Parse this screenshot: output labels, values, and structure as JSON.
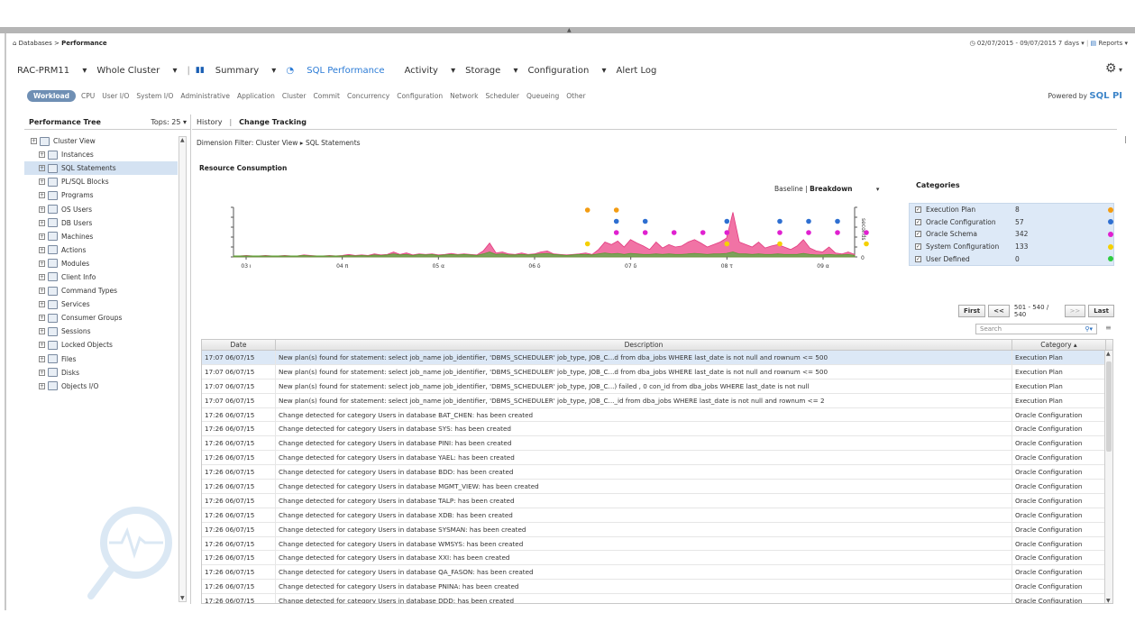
{
  "breadcrumb": {
    "root": "Databases",
    "separator": ">",
    "current": "Performance"
  },
  "date_range": {
    "text": "02/07/2015 - 09/07/2015 7 days",
    "reports": "Reports"
  },
  "nav": {
    "db": "RAC-PRM11",
    "scope": "Whole Cluster",
    "items": [
      "Summary",
      "SQL Performance",
      "Activity",
      "Storage",
      "Configuration",
      "Alert Log"
    ]
  },
  "workload_tabs": [
    "Workload",
    "CPU",
    "User I/O",
    "System I/O",
    "Administrative",
    "Application",
    "Cluster",
    "Commit",
    "Concurrency",
    "Configuration",
    "Network",
    "Scheduler",
    "Queueing",
    "Other"
  ],
  "powered_by": {
    "prefix": "Powered by",
    "brand": "SQL PI"
  },
  "perf_tree": {
    "title": "Performance Tree",
    "tops": "Tops: 25",
    "items": [
      "Cluster View",
      "Instances",
      "SQL Statements",
      "PL/SQL Blocks",
      "Programs",
      "OS Users",
      "DB Users",
      "Machines",
      "Actions",
      "Modules",
      "Client Info",
      "Command Types",
      "Services",
      "Consumer Groups",
      "Sessions",
      "Locked Objects",
      "Files",
      "Disks",
      "Objects I/O"
    ],
    "selected_index": 2
  },
  "content_tabs": {
    "history": "History",
    "separator": "|",
    "change_tracking": "Change Tracking"
  },
  "dimension_filter": "Dimension Filter: Cluster View ▸ SQL Statements",
  "resource_title": "Resource Consumption",
  "baseline": {
    "baseline": "Baseline",
    "separator": "|",
    "breakdown": "Breakdown"
  },
  "categories": {
    "title": "Categories",
    "items": [
      {
        "name": "Execution Plan",
        "count": "8",
        "color": "#f39c12"
      },
      {
        "name": "Oracle Configuration",
        "count": "57",
        "color": "#2e6fd1"
      },
      {
        "name": "Oracle Schema",
        "count": "342",
        "color": "#e020d0"
      },
      {
        "name": "System Configuration",
        "count": "133",
        "color": "#f5d000"
      },
      {
        "name": "User Defined",
        "count": "0",
        "color": "#2ecc40"
      }
    ]
  },
  "chart_data": {
    "type": "area",
    "x_ticks": [
      "03 ı",
      "04 π",
      "05 α",
      "06 δ",
      "07 δ",
      "08 τ",
      "09 α"
    ],
    "ylabel": "seconds",
    "y_ticks": [
      "0"
    ],
    "series": [
      {
        "values": [
          0.02,
          0.02,
          0.03,
          0.02,
          0.02,
          0.03,
          0.02,
          0.02,
          0.03,
          0.02,
          0.02,
          0.04,
          0.03,
          0.02,
          0.02,
          0.03,
          0.02,
          0.03,
          0.05,
          0.03,
          0.04,
          0.03,
          0.06,
          0.04,
          0.05,
          0.1,
          0.05,
          0.08,
          0.04,
          0.06,
          0.05,
          0.06,
          0.04,
          0.05,
          0.07,
          0.05,
          0.06,
          0.05,
          0.04,
          0.12,
          0.28,
          0.08,
          0.1,
          0.06,
          0.05,
          0.08,
          0.05,
          0.06,
          0.1,
          0.12,
          0.06,
          0.05,
          0.04,
          0.05,
          0.06,
          0.08,
          0.05,
          0.15,
          0.3,
          0.25,
          0.32,
          0.2,
          0.35,
          0.28,
          0.22,
          0.15,
          0.3,
          0.18,
          0.25,
          0.2,
          0.22,
          0.3,
          0.35,
          0.28,
          0.2,
          0.25,
          0.3,
          0.38,
          0.9,
          0.3,
          0.25,
          0.2,
          0.3,
          0.18,
          0.22,
          0.25,
          0.2,
          0.15,
          0.22,
          0.35,
          0.18,
          0.12,
          0.1,
          0.2,
          0.08,
          0.06,
          0.1,
          0.05
        ]
      },
      {
        "values": [
          0.02,
          0.02,
          0.02,
          0.02,
          0.02,
          0.02,
          0.02,
          0.02,
          0.02,
          0.02,
          0.02,
          0.03,
          0.02,
          0.02,
          0.02,
          0.02,
          0.02,
          0.02,
          0.03,
          0.02,
          0.03,
          0.02,
          0.04,
          0.03,
          0.04,
          0.06,
          0.04,
          0.05,
          0.03,
          0.05,
          0.04,
          0.05,
          0.03,
          0.04,
          0.05,
          0.04,
          0.05,
          0.04,
          0.03,
          0.06,
          0.1,
          0.05,
          0.06,
          0.04,
          0.04,
          0.05,
          0.04,
          0.05,
          0.06,
          0.07,
          0.05,
          0.04,
          0.03,
          0.04,
          0.05,
          0.05,
          0.04,
          0.06,
          0.08,
          0.06,
          0.07,
          0.05,
          0.07,
          0.06,
          0.05,
          0.05,
          0.06,
          0.05,
          0.06,
          0.05,
          0.05,
          0.06,
          0.07,
          0.06,
          0.05,
          0.06,
          0.06,
          0.07,
          0.1,
          0.06,
          0.06,
          0.05,
          0.06,
          0.05,
          0.05,
          0.06,
          0.05,
          0.05,
          0.05,
          0.07,
          0.05,
          0.04,
          0.04,
          0.05,
          0.04,
          0.04,
          0.05,
          0.03
        ]
      }
    ],
    "markers": [
      {
        "x_tick": 4,
        "offset": -0.45,
        "rows": [
          "Execution Plan",
          "System Configuration"
        ]
      },
      {
        "x_tick": 4,
        "offset": -0.15,
        "rows": [
          "Execution Plan",
          "Oracle Configuration",
          "Oracle Schema"
        ]
      },
      {
        "x_tick": 4,
        "offset": 0.15,
        "rows": [
          "Oracle Configuration",
          "Oracle Schema"
        ]
      },
      {
        "x_tick": 4,
        "offset": 0.45,
        "rows": [
          "Oracle Schema"
        ]
      },
      {
        "x_tick": 5,
        "offset": -0.25,
        "rows": [
          "Oracle Schema"
        ]
      },
      {
        "x_tick": 5,
        "offset": 0.0,
        "rows": [
          "Oracle Configuration",
          "Oracle Schema",
          "System Configuration"
        ]
      },
      {
        "x_tick": 5,
        "offset": 0.55,
        "rows": [
          "Oracle Configuration",
          "Oracle Schema",
          "System Configuration"
        ]
      },
      {
        "x_tick": 6,
        "offset": -0.15,
        "rows": [
          "Oracle Configuration",
          "Oracle Schema"
        ]
      },
      {
        "x_tick": 6,
        "offset": 0.15,
        "rows": [
          "Oracle Configuration",
          "Oracle Schema"
        ]
      },
      {
        "x_tick": 6,
        "offset": 0.45,
        "rows": [
          "Oracle Schema",
          "System Configuration"
        ]
      },
      {
        "x_tick": 6,
        "offset": 0.75,
        "rows": [
          "Oracle Schema",
          "System Configuration"
        ]
      }
    ]
  },
  "pager": {
    "first": "First",
    "prev": "<<",
    "info": "501 - 540 / 540",
    "next": ">>",
    "last": "Last"
  },
  "search": {
    "placeholder": "Search"
  },
  "grid": {
    "columns": [
      "Date",
      "Description",
      "Category ▴"
    ],
    "selected_index": 0,
    "rows": [
      {
        "date": "17:07 06/07/15",
        "desc": "New plan(s) found for statement: select job_name job_identifier, 'DBMS_SCHEDULER' job_type, JOB_C...d from dba_jobs WHERE last_date is not null and rownum <= 500",
        "cat": "Execution Plan"
      },
      {
        "date": "17:07 06/07/15",
        "desc": "New plan(s) found for statement: select job_name job_identifier, 'DBMS_SCHEDULER' job_type, JOB_C...d from dba_jobs WHERE last_date is not null and rownum <= 500",
        "cat": "Execution Plan"
      },
      {
        "date": "17:07 06/07/15",
        "desc": "New plan(s) found for statement: select job_name job_identifier, 'DBMS_SCHEDULER' job_type, JOB_C...) failed , 0 con_id from dba_jobs WHERE last_date is not null",
        "cat": "Execution Plan"
      },
      {
        "date": "17:07 06/07/15",
        "desc": "New plan(s) found for statement: select job_name job_identifier, 'DBMS_SCHEDULER' job_type, JOB_C..._id from dba_jobs WHERE last_date is not null and rownum <= 2",
        "cat": "Execution Plan"
      },
      {
        "date": "17:26 06/07/15",
        "desc": "Change detected for category Users in database BAT_CHEN: has been created",
        "cat": "Oracle Configuration"
      },
      {
        "date": "17:26 06/07/15",
        "desc": "Change detected for category Users in database SYS: has been created",
        "cat": "Oracle Configuration"
      },
      {
        "date": "17:26 06/07/15",
        "desc": "Change detected for category Users in database PINI: has been created",
        "cat": "Oracle Configuration"
      },
      {
        "date": "17:26 06/07/15",
        "desc": "Change detected for category Users in database YAEL: has been created",
        "cat": "Oracle Configuration"
      },
      {
        "date": "17:26 06/07/15",
        "desc": "Change detected for category Users in database BDD: has been created",
        "cat": "Oracle Configuration"
      },
      {
        "date": "17:26 06/07/15",
        "desc": "Change detected for category Users in database MGMT_VIEW: has been created",
        "cat": "Oracle Configuration"
      },
      {
        "date": "17:26 06/07/15",
        "desc": "Change detected for category Users in database TALP: has been created",
        "cat": "Oracle Configuration"
      },
      {
        "date": "17:26 06/07/15",
        "desc": "Change detected for category Users in database XDB: has been created",
        "cat": "Oracle Configuration"
      },
      {
        "date": "17:26 06/07/15",
        "desc": "Change detected for category Users in database SYSMAN: has been created",
        "cat": "Oracle Configuration"
      },
      {
        "date": "17:26 06/07/15",
        "desc": "Change detected for category Users in database WMSYS: has been created",
        "cat": "Oracle Configuration"
      },
      {
        "date": "17:26 06/07/15",
        "desc": "Change detected for category Users in database XXI: has been created",
        "cat": "Oracle Configuration"
      },
      {
        "date": "17:26 06/07/15",
        "desc": "Change detected for category Users in database QA_FASON: has been created",
        "cat": "Oracle Configuration"
      },
      {
        "date": "17:26 06/07/15",
        "desc": "Change detected for category Users in database PNINA: has been created",
        "cat": "Oracle Configuration"
      },
      {
        "date": "17:26 06/07/15",
        "desc": "Change detected for category Users in database DDD: has been created",
        "cat": "Oracle Configuration"
      }
    ]
  }
}
